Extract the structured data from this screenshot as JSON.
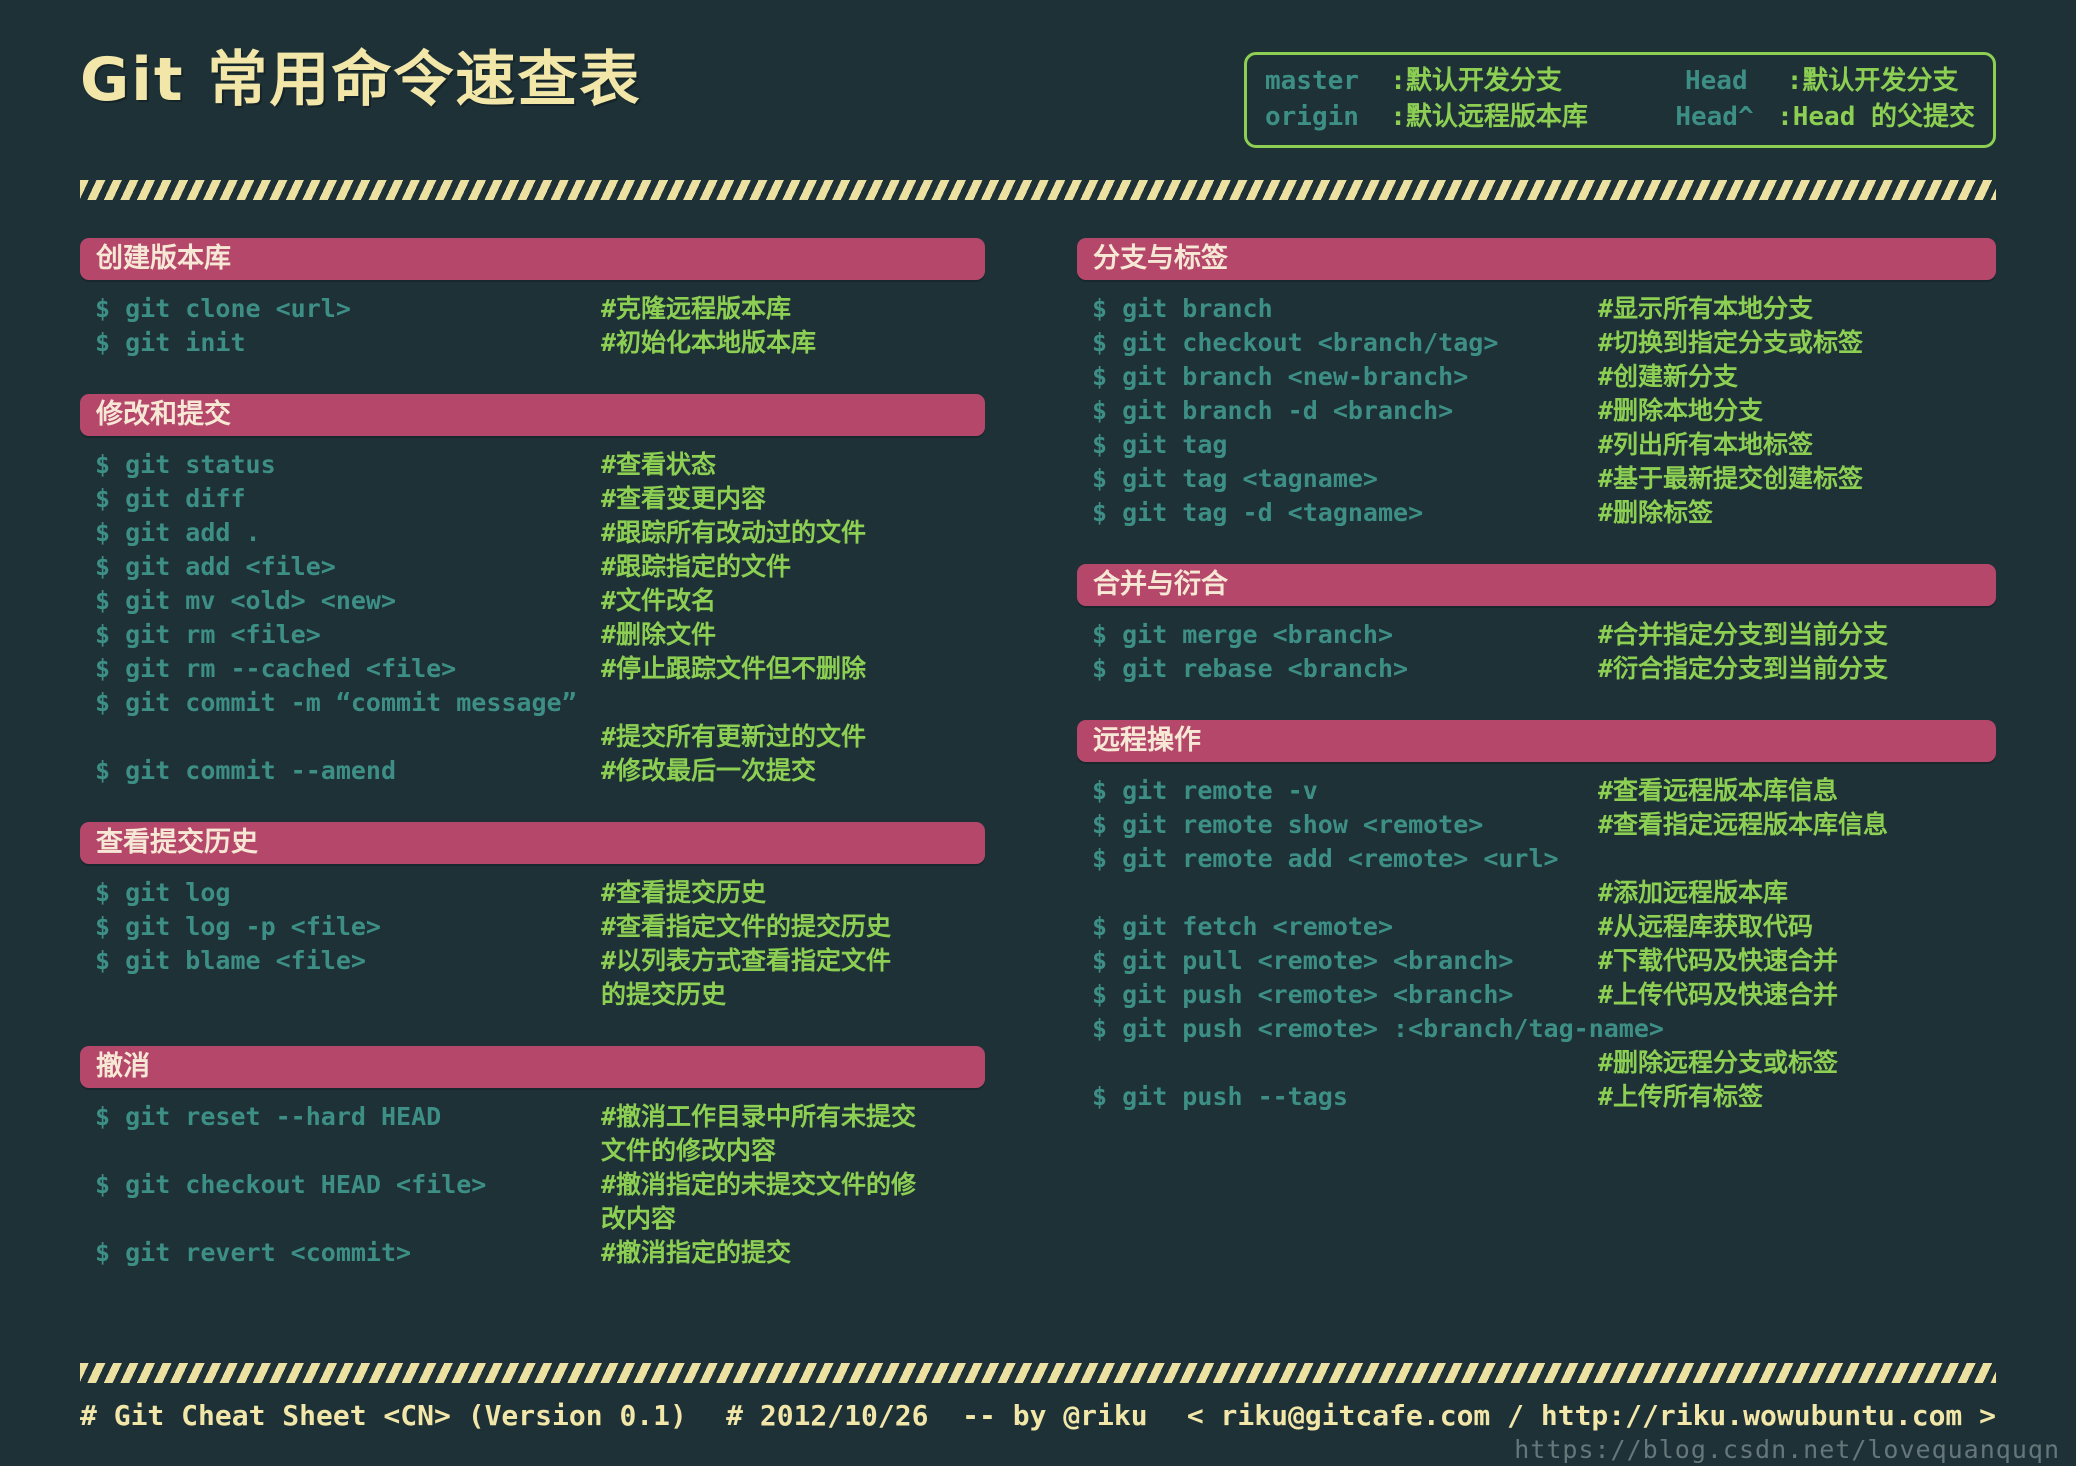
{
  "title": "Git 常用命令速查表",
  "legend": {
    "rows": [
      {
        "k1": "master",
        "d1": ":默认开发分支",
        "k2": "Head",
        "d2": ":默认开发分支"
      },
      {
        "k1": "origin",
        "d1": ":默认远程版本库",
        "k2": "Head^",
        "d2": ":Head 的父提交"
      }
    ]
  },
  "columns": [
    {
      "name": "left",
      "sections": [
        {
          "header": "创建版本库",
          "rows": [
            {
              "cmd": "$ git clone <url>",
              "comment": "#克隆远程版本库"
            },
            {
              "cmd": "$ git init",
              "comment": "#初始化本地版本库"
            }
          ]
        },
        {
          "header": "修改和提交",
          "rows": [
            {
              "cmd": "$ git status",
              "comment": "#查看状态"
            },
            {
              "cmd": "$ git diff",
              "comment": "#查看变更内容"
            },
            {
              "cmd": "$ git add .",
              "comment": "#跟踪所有改动过的文件"
            },
            {
              "cmd": "$ git add <file>",
              "comment": "#跟踪指定的文件"
            },
            {
              "cmd": "$ git mv <old> <new>",
              "comment": "#文件改名"
            },
            {
              "cmd": "$ git rm <file>",
              "comment": "#删除文件"
            },
            {
              "cmd": "$ git rm --cached <file>",
              "comment": "#停止跟踪文件但不删除"
            },
            {
              "cmd": "$ git commit -m “commit message”",
              "comment": ""
            },
            {
              "cmd": "",
              "comment": "#提交所有更新过的文件"
            },
            {
              "cmd": "$ git commit --amend",
              "comment": "#修改最后一次提交"
            }
          ]
        },
        {
          "header": "查看提交历史",
          "rows": [
            {
              "cmd": "$ git log",
              "comment": "#查看提交历史"
            },
            {
              "cmd": "$ git log -p <file>",
              "comment": "#查看指定文件的提交历史"
            },
            {
              "cmd": "$ git blame <file>",
              "comment": "#以列表方式查看指定文件\n的提交历史"
            }
          ]
        },
        {
          "header": "撤消",
          "rows": [
            {
              "cmd": "$ git reset --hard HEAD",
              "comment": "#撤消工作目录中所有未提交\n文件的修改内容"
            },
            {
              "cmd": "$ git checkout HEAD <file>",
              "comment": "#撤消指定的未提交文件的修\n改内容"
            },
            {
              "cmd": "$ git revert <commit>",
              "comment": "#撤消指定的提交"
            }
          ]
        }
      ]
    },
    {
      "name": "right",
      "sections": [
        {
          "header": "分支与标签",
          "rows": [
            {
              "cmd": "$ git branch",
              "comment": "#显示所有本地分支"
            },
            {
              "cmd": "$ git checkout <branch/tag>",
              "comment": "#切换到指定分支或标签"
            },
            {
              "cmd": "$ git branch <new-branch>",
              "comment": "#创建新分支"
            },
            {
              "cmd": "$ git branch -d <branch>",
              "comment": "#删除本地分支"
            },
            {
              "cmd": "$ git tag",
              "comment": "#列出所有本地标签"
            },
            {
              "cmd": "$ git tag <tagname>",
              "comment": "#基于最新提交创建标签"
            },
            {
              "cmd": "$ git tag -d <tagname>",
              "comment": "#删除标签"
            }
          ]
        },
        {
          "header": "合并与衍合",
          "rows": [
            {
              "cmd": "$ git merge <branch>",
              "comment": "#合并指定分支到当前分支"
            },
            {
              "cmd": "$ git rebase <branch>",
              "comment": "#衍合指定分支到当前分支"
            }
          ]
        },
        {
          "header": "远程操作",
          "rows": [
            {
              "cmd": "$ git remote -v",
              "comment": "#查看远程版本库信息"
            },
            {
              "cmd": "$ git remote show <remote>",
              "comment": "#查看指定远程版本库信息"
            },
            {
              "cmd": "$ git remote add <remote> <url>",
              "comment": ""
            },
            {
              "cmd": "",
              "comment": "#添加远程版本库"
            },
            {
              "cmd": "$ git fetch <remote>",
              "comment": "#从远程库获取代码"
            },
            {
              "cmd": "$ git pull <remote> <branch>",
              "comment": "#下载代码及快速合并"
            },
            {
              "cmd": "$ git push <remote> <branch>",
              "comment": "#上传代码及快速合并"
            },
            {
              "cmd": "$ git push <remote> :<branch/tag-name>",
              "comment": ""
            },
            {
              "cmd": "",
              "comment": "#删除远程分支或标签"
            },
            {
              "cmd": "$ git push --tags",
              "comment": "#上传所有标签"
            }
          ]
        }
      ]
    }
  ],
  "footer": {
    "left": "# Git Cheat Sheet <CN> (Version 0.1)",
    "middle": "# 2012/10/26  -- by @riku",
    "right": "< riku@gitcafe.com / http://riku.wowubuntu.com >"
  },
  "watermark": "https://blog.csdn.net/lovequanquqn",
  "colors": {
    "background": "#1d3137",
    "section_bar": "#b5476b",
    "section_bar_text": "#f6e8d5",
    "command": "#3d8f86",
    "comment": "#8ccf53",
    "cream": "#f2e7a8",
    "legend_border": "#8ccf53",
    "watermark": "#6f7f82"
  }
}
